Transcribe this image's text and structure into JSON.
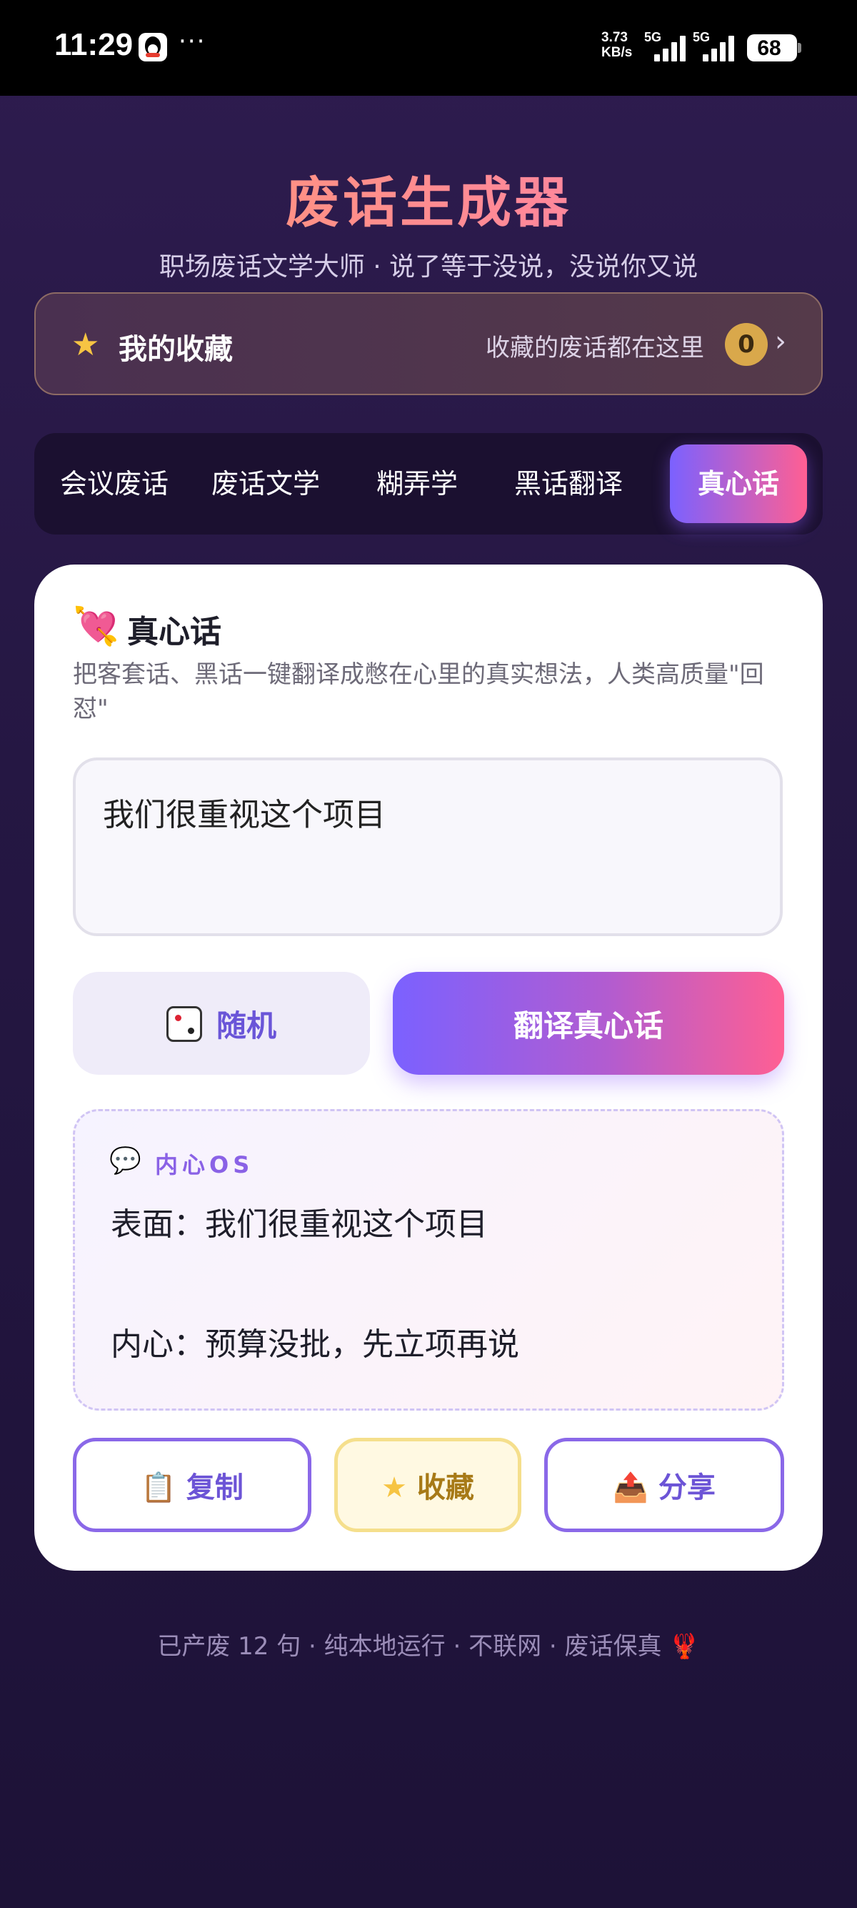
{
  "status_bar": {
    "time": "11:29",
    "more": "···",
    "net_speed_value": "3.73",
    "net_speed_unit": "KB/s",
    "signal1_label": "5G",
    "signal2_label": "5G",
    "battery": "68"
  },
  "header": {
    "title": "废话生成器",
    "subtitle": "职场废话文学大师 · 说了等于没说，没说你又说"
  },
  "favorites_bar": {
    "icon": "star-icon",
    "title": "我的收藏",
    "hint": "收藏的废话都在这里",
    "count": "0",
    "chevron": "›"
  },
  "tabs": [
    {
      "label": "会议废话",
      "active": false
    },
    {
      "label": "废话文学",
      "active": false
    },
    {
      "label": "糊弄学",
      "active": false
    },
    {
      "label": "黑话翻译",
      "active": false
    },
    {
      "label": "真心话",
      "active": true
    }
  ],
  "card": {
    "icon": "heart-arrow-icon",
    "title": "真心话",
    "description": "把客套话、黑话一键翻译成憋在心里的真实想法，人类高质量\"回怼\"",
    "input_value": "我们很重视这个项目",
    "random_button": "随机",
    "translate_button": "翻译真心话",
    "result": {
      "label": "内心OS",
      "surface": "表面：我们很重视这个项目",
      "inner": "内心：预算没批，先立项再说"
    },
    "actions": {
      "copy": "复制",
      "favorite": "收藏",
      "share": "分享"
    }
  },
  "footer": {
    "text": "已产废 12 句 · 纯本地运行 · 不联网 · 废话保真 🦞"
  },
  "colors": {
    "accent_start": "#7b61ff",
    "accent_end": "#ff5f93",
    "title_gradient_start": "#ff9a6e",
    "title_gradient_end": "#ff7eb3",
    "background": "#251743"
  }
}
